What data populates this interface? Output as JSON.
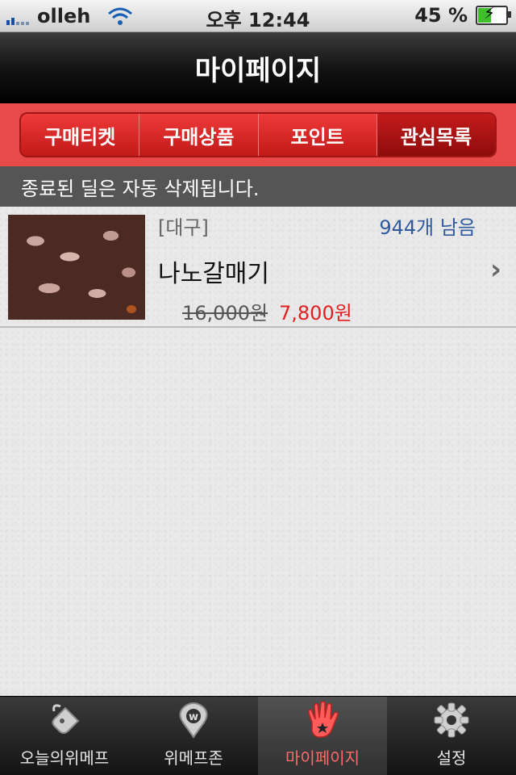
{
  "status_bar": {
    "carrier": "olleh",
    "time": "오후 12:44",
    "battery": "45 %"
  },
  "nav": {
    "title": "마이페이지"
  },
  "segments": [
    {
      "label": "구매티켓"
    },
    {
      "label": "구매상품"
    },
    {
      "label": "포인트"
    },
    {
      "label": "관심목록"
    }
  ],
  "notice": "종료된 딜은 자동 삭제됩니다.",
  "items": [
    {
      "region": "[대구]",
      "remaining": "944개 남음",
      "name": "나노갈매기",
      "original_price": "16,000원",
      "sale_price": "7,800원"
    }
  ],
  "tabs": [
    {
      "label": "오늘의위메프",
      "icon": "tag-icon"
    },
    {
      "label": "위메프존",
      "icon": "map-pin-w-icon"
    },
    {
      "label": "마이페이지",
      "icon": "hand-star-icon"
    },
    {
      "label": "설정",
      "icon": "gear-icon"
    }
  ],
  "colors": {
    "accent_red": "#e84a4a",
    "price_red": "#e02020",
    "remaining_blue": "#2f5a9e",
    "active_tab": "#ff6b6b"
  }
}
